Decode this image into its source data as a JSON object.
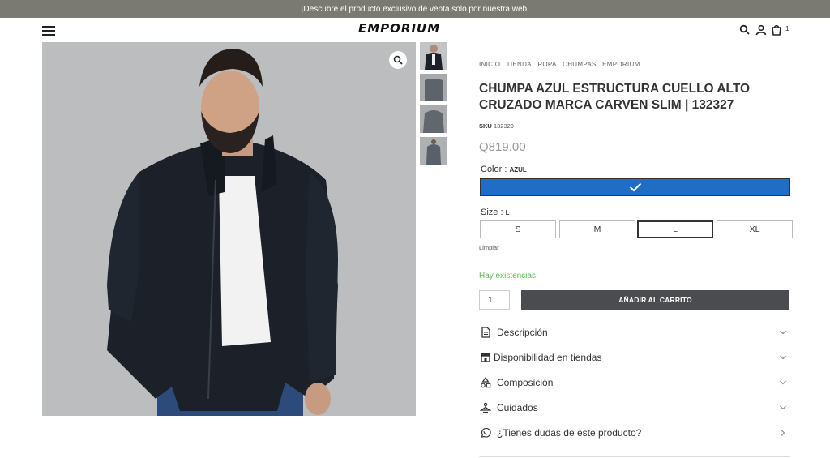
{
  "topbar": {
    "text": "¡Descubre el producto exclusivo de venta solo por nuestra web!"
  },
  "header": {
    "logo": "EMPORIUM",
    "cart_count": "1",
    "icons": [
      "menu-icon",
      "search-icon",
      "user-icon",
      "cart-icon"
    ]
  },
  "gallery": {
    "main_image": "man wearing navy blue high-collar jacket",
    "thumbnail_count": 4
  },
  "product": {
    "breadcrumb": [
      "INICIO",
      "TIENDA",
      "ROPA",
      "CHUMPAS",
      "EMPORIUM"
    ],
    "title": "CHUMPA AZUL ESTRUCTURA CUELLO ALTO CRUZADO MARCA CARVEN SLIM | 132327",
    "sku_label": "SKU",
    "sku_value": "132329",
    "price": "Q819.00",
    "color_label": "Color :",
    "color_value": "AZUL",
    "swatch_color": "#1f6dc5",
    "size_label": "Size :",
    "size_value": "L",
    "sizes": [
      "S",
      "M",
      "L",
      "XL"
    ],
    "selected_size": "L",
    "clear_label": "Limpiar",
    "stock_text": "Hay existencias",
    "stock_color": "#5cb85c",
    "quantity": "1",
    "add_to_cart": "AÑADIR AL CARRITO"
  },
  "accordion": [
    {
      "label": "Descripción",
      "icon": "document-icon"
    },
    {
      "label": "Disponibilidad en tiendas",
      "icon": "store-icon"
    },
    {
      "label": "Composición",
      "icon": "shapes-icon"
    },
    {
      "label": "Cuidados",
      "icon": "care-icon"
    },
    {
      "label": "¿Tienes dudas de este producto?",
      "icon": "whatsapp-icon"
    }
  ]
}
